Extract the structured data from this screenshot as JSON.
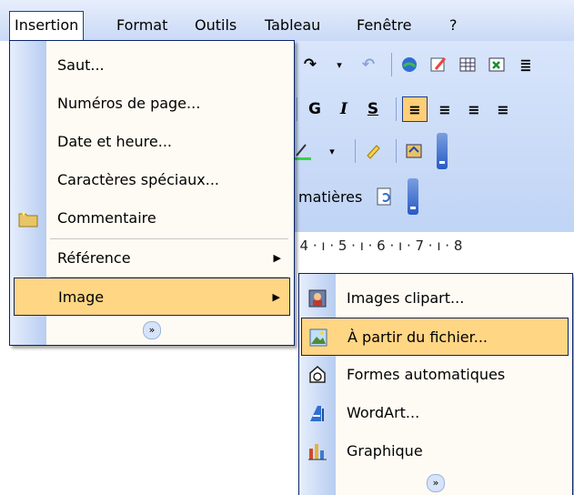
{
  "menubar": {
    "items": [
      "Insertion",
      "Format",
      "Outils",
      "Tableau",
      "Fenêtre",
      "?"
    ]
  },
  "toolbar": {
    "bold": "G",
    "italic": "I",
    "underline": "S",
    "toc_label": "matières"
  },
  "ruler": {
    "text": "· 4 · ı · 5 · ı · 6 · ı · 7 · ı · 8"
  },
  "insertion_menu": {
    "items": [
      {
        "label": "Saut..."
      },
      {
        "label": "Numéros de page..."
      },
      {
        "label": "Date et heure..."
      },
      {
        "label": "Caractères spéciaux..."
      },
      {
        "label": "Commentaire",
        "icon": "comment-folder-icon"
      },
      {
        "label": "Référence",
        "submenu": true
      },
      {
        "label": "Image",
        "submenu": true,
        "highlighted": true
      }
    ]
  },
  "image_submenu": {
    "items": [
      {
        "label": "Images clipart...",
        "icon": "clipart-icon"
      },
      {
        "label": "À partir du fichier...",
        "icon": "picture-file-icon",
        "highlighted": true
      },
      {
        "label": "Formes automatiques",
        "icon": "autoshapes-icon"
      },
      {
        "label": "WordArt...",
        "icon": "wordart-icon"
      },
      {
        "label": "Graphique",
        "icon": "chart-icon"
      }
    ]
  },
  "colors": {
    "accent": "#0a246a",
    "highlight": "#ffd684",
    "menu_bg": "#fdfbf3"
  }
}
